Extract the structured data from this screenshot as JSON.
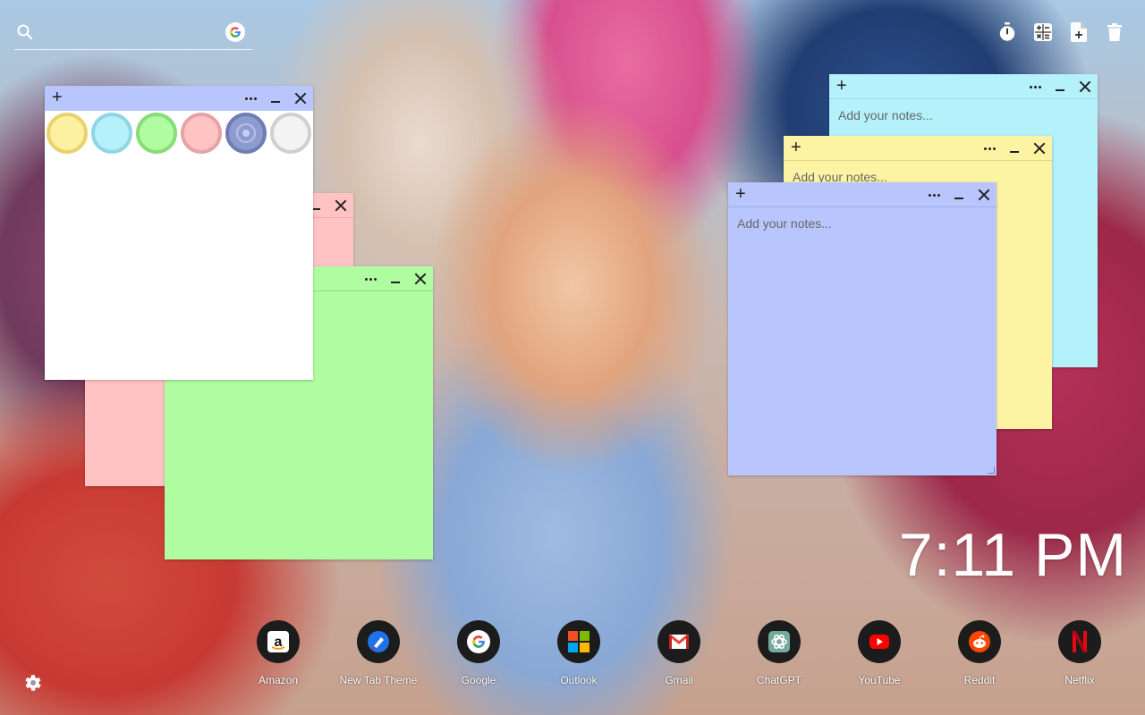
{
  "search": {
    "placeholder": ""
  },
  "icons": {
    "search": "search-icon",
    "google": "google-icon",
    "timer": "stopwatch-icon",
    "calculator": "calculator-icon",
    "add_document": "add-document-icon",
    "trash": "trash-icon",
    "settings": "gear-icon"
  },
  "toolbar": {
    "plus_label": "+"
  },
  "notes": [
    {
      "id": "cyan",
      "color": "#b4f1fb",
      "placeholder": "Add your notes..."
    },
    {
      "id": "yellow",
      "color": "#fdf4a3",
      "placeholder": "Add your notes..."
    },
    {
      "id": "blue",
      "color": "#b9c6fd",
      "placeholder": "Add your notes..."
    },
    {
      "id": "pink",
      "color": "#ffc3c4",
      "placeholder": ""
    },
    {
      "id": "green",
      "color": "#b0fda1",
      "placeholder": ""
    },
    {
      "id": "white",
      "color": "#ffffff",
      "placeholder": ""
    }
  ],
  "color_picker": {
    "swatches": [
      {
        "name": "yellow",
        "fill": "#fdf0a0",
        "ring": "#e8d36b"
      },
      {
        "name": "cyan",
        "fill": "#b4f1fb",
        "ring": "#8fd6e4"
      },
      {
        "name": "green",
        "fill": "#b0fda1",
        "ring": "#89dd79"
      },
      {
        "name": "pink",
        "fill": "#ffc3c4",
        "ring": "#e6a3a5"
      },
      {
        "name": "blue",
        "fill": "#8e9bce",
        "ring": "#6f7db3",
        "selected": true
      },
      {
        "name": "white",
        "fill": "#f3f3f3",
        "ring": "#d0d0d0"
      }
    ]
  },
  "clock": {
    "time": "7:11 PM"
  },
  "dock": [
    {
      "label": "Amazon",
      "icon": "amazon-icon"
    },
    {
      "label": "New Tab Theme",
      "icon": "new-tab-theme-icon"
    },
    {
      "label": "Google",
      "icon": "google-icon"
    },
    {
      "label": "Outlook",
      "icon": "outlook-icon"
    },
    {
      "label": "Gmail",
      "icon": "gmail-icon"
    },
    {
      "label": "ChatGPT",
      "icon": "chatgpt-icon"
    },
    {
      "label": "YouTube",
      "icon": "youtube-icon"
    },
    {
      "label": "Reddit",
      "icon": "reddit-icon"
    },
    {
      "label": "Netflix",
      "icon": "netflix-icon"
    }
  ]
}
